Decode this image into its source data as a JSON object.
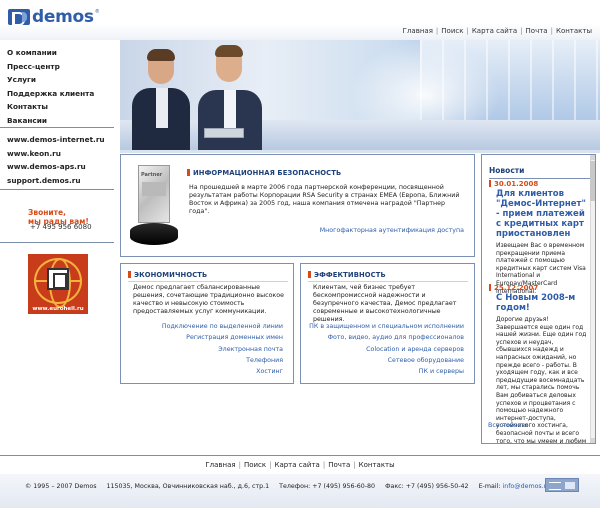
{
  "header": {
    "logo_text": "demos",
    "logo_reg": "®",
    "nav": [
      "Главная",
      "Поиск",
      "Карта сайта",
      "Почта",
      "Контакты"
    ]
  },
  "sidebar": {
    "menu": [
      "О компании",
      "Пресс-центр",
      "Услуги",
      "Поддержка клиента",
      "Контакты",
      "Вакансии"
    ],
    "sites": [
      "www.demos-internet.ru",
      "www.keon.ru",
      "www.demos-aps.ru",
      "support.demos.ru"
    ],
    "call_line1": "Звоните,",
    "call_line2": "мы рады вам!",
    "phone": "+7 495 956 6080",
    "banner_text": "www.eurohell.ru"
  },
  "security": {
    "title": "ИНФОРМАЦИОННАЯ БЕЗОПАСНОСТЬ",
    "text": "На прошедшей в марте 2006 года партнерской конференции, посвященной результатам работы Корпорации RSA Security в странах EMEA (Европа, Ближний Восток и Африка) за 2005 год, наша компания отмечена наградой \"Партнер года\".",
    "link": "Многофакторная аутентификация доступа"
  },
  "economy": {
    "title": "ЭКОНОМИЧНОСТЬ",
    "text": "Демос предлагает сбалансированные решения, сочетающие традиционно высокое качество и невысокую стоимость предоставляемых услуг коммуникации.",
    "links": [
      "Подключение по выделенной линии",
      "Регистрация доменных имен",
      "Электронная почта",
      "Телефония",
      "Хостинг"
    ]
  },
  "efficiency": {
    "title": "ЭФФЕКТИВНОСТЬ",
    "text": "Клиентам, чей бизнес требует бескомпромиссной надежности и безупречного качества, Демос предлагает современные и высокотехнологичные решения.",
    "links": [
      "ПК в защищенном и специальном исполнении",
      "Фото, видео, аудио для профессионалов",
      "Colocation и аренда серверов",
      "Сетевое оборудование",
      "ПК и серверы"
    ]
  },
  "news": {
    "title": "Новости",
    "items": [
      {
        "date": "30.01.2008",
        "headline": "Для клиентов \"Демос-Интернет\" - прием платежей с кредитных карт приостановлен",
        "text": "Извещаем Вас о временном прекращении приема платежей с помощью кредитных карт систем Visa International и Europay/MasterCard International."
      },
      {
        "date": "25.12.2007",
        "headline": "С Новым 2008-м годом!",
        "text": "Дорогие друзья! Завершается еще один год нашей жизни. Еще один год успехов и неудач, сбывшихся надежд и напрасных ожиданий, но прежде всего - работы. В уходящем году, как и все предыдущие восемнадцать лет, мы старались помочь Вам добиваться деловых успехов и процветания с помощью надежного интернет-доступа, устойчивого хостинга, безопасной почты и всего того, что мы умеем и любим делать."
      }
    ],
    "all_link": "Все новости"
  },
  "footer": {
    "nav": [
      "Главная",
      "Поиск",
      "Карта сайта",
      "Почта",
      "Контакты"
    ],
    "copyright": "© 1995 – 2007 Demos",
    "address": "115035, Москва, Овчинниковская наб., д.6, стр.1",
    "phone": "Телефон: +7 (495) 956-60-80",
    "fax": "Факс: +7 (495) 956-50-42",
    "email_label": "E-mail:",
    "email": "info@demos.ru"
  }
}
